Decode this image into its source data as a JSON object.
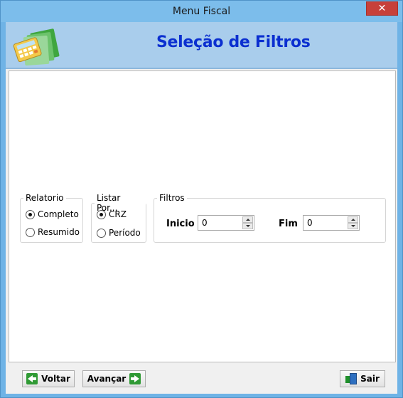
{
  "window": {
    "title": "Menu Fiscal",
    "close_symbol": "✕"
  },
  "header": {
    "title": "Seleção de Filtros",
    "logo_icon": "calculator-folder-icon"
  },
  "groups": {
    "relatorio": {
      "legend": "Relatorio",
      "options": [
        {
          "label": "Completo",
          "checked": true
        },
        {
          "label": "Resumido",
          "checked": false
        }
      ]
    },
    "listar_por": {
      "legend": "Listar Por...",
      "options": [
        {
          "label": "CRZ",
          "checked": true
        },
        {
          "label": "Período",
          "checked": false
        }
      ]
    },
    "filtros": {
      "legend": "Filtros",
      "inicio_label": "Inicio",
      "inicio_value": "0",
      "fim_label": "Fim",
      "fim_value": "0"
    }
  },
  "footer": {
    "back_label": "Voltar",
    "next_label": "Avançar",
    "exit_label": "Sair"
  },
  "colors": {
    "title_bar": "#7cbdeb",
    "header_band": "#a9cdec",
    "header_title": "#0b2fd0",
    "close_button": "#c7403a",
    "arrow_green": "#2f9a34"
  }
}
